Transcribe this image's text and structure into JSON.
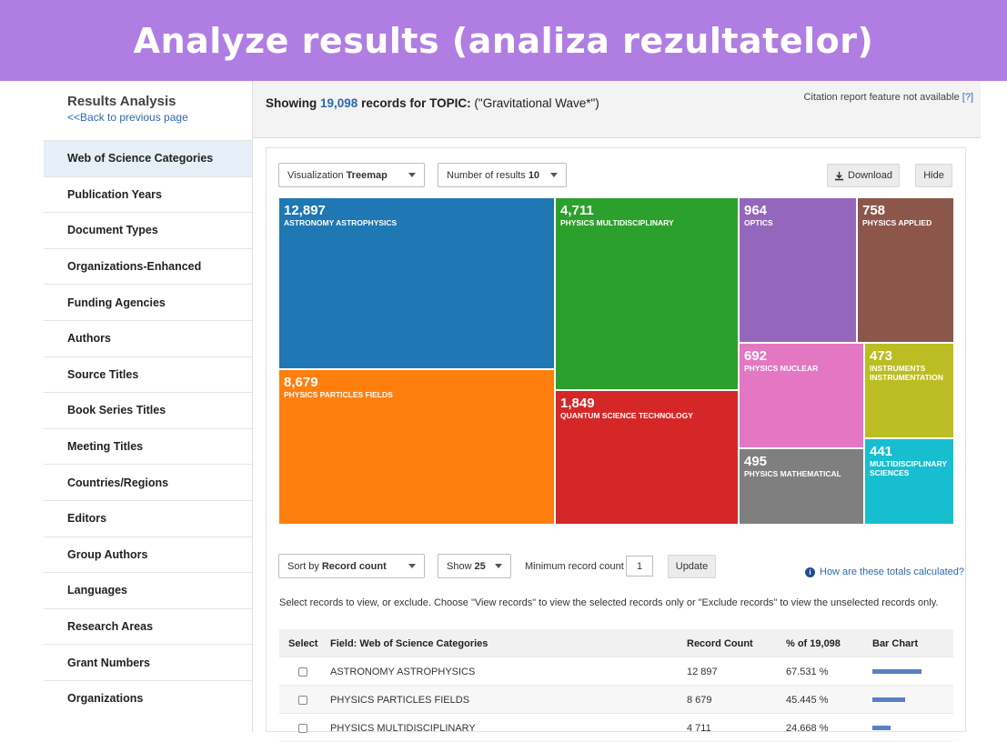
{
  "banner": {
    "title": "Analyze results (analiza rezultatelor)"
  },
  "sidebar": {
    "title": "Results Analysis",
    "back_link": "<<Back to previous page",
    "items": [
      "Web of Science Categories",
      "Publication Years",
      "Document Types",
      "Organizations-Enhanced",
      "Funding Agencies",
      "Authors",
      "Source Titles",
      "Book Series Titles",
      "Meeting Titles",
      "Countries/Regions",
      "Editors",
      "Group Authors",
      "Languages",
      "Research Areas",
      "Grant Numbers",
      "Organizations"
    ],
    "active_index": 0
  },
  "header": {
    "showing_prefix": "Showing",
    "record_count": "19,098",
    "records_for": "records for",
    "topic_label": "TOPIC:",
    "topic_query": "(\"Gravitational Wave*\")",
    "citation_note": "Citation report feature not available",
    "citation_help": "[?]"
  },
  "controls": {
    "visualization_label": "Visualization",
    "visualization_value": "Treemap",
    "num_results_label": "Number of results",
    "num_results_value": "10",
    "download_label": "Download",
    "hide_label": "Hide"
  },
  "treemap": {
    "colors": {
      "astronomy": "#1f77b4",
      "particles": "#ff7f0e",
      "multidisciplinary": "#2ca02c",
      "quantum": "#d62728",
      "optics": "#9467bd",
      "applied": "#8c564b",
      "nuclear": "#e377c2",
      "instruments": "#bcbd22",
      "mathematical": "#7f7f7f",
      "multi_sciences": "#17becf"
    },
    "cells": [
      {
        "value": "12,897",
        "label": "ASTRONOMY ASTROPHYSICS"
      },
      {
        "value": "8,679",
        "label": "PHYSICS PARTICLES FIELDS"
      },
      {
        "value": "4,711",
        "label": "PHYSICS MULTIDISCIPLINARY"
      },
      {
        "value": "1,849",
        "label": "QUANTUM SCIENCE TECHNOLOGY"
      },
      {
        "value": "964",
        "label": "OPTICS"
      },
      {
        "value": "758",
        "label": "PHYSICS APPLIED"
      },
      {
        "value": "692",
        "label": "PHYSICS NUCLEAR"
      },
      {
        "value": "473",
        "label": "INSTRUMENTS INSTRUMENTATION"
      },
      {
        "value": "495",
        "label": "PHYSICS MATHEMATICAL"
      },
      {
        "value": "441",
        "label": "MULTIDISCIPLINARY SCIENCES"
      }
    ]
  },
  "filters": {
    "sort_label": "Sort by",
    "sort_value": "Record count",
    "show_label": "Show",
    "show_value": "25",
    "min_label": "Minimum record count",
    "min_value": "1",
    "update_label": "Update",
    "how_link": "How are these totals calculated?"
  },
  "instructions": "Select records to view, or exclude. Choose \"View records\" to view the selected records only or \"Exclude records\" to view the unselected records only.",
  "table": {
    "headers": {
      "select": "Select",
      "field": "Field: Web of Science Categories",
      "count": "Record Count",
      "percent": "% of 19,098",
      "bar": "Bar Chart"
    },
    "rows": [
      {
        "field": "ASTRONOMY ASTROPHYSICS",
        "count": "12 897",
        "percent": "67.531 %",
        "share": 0.67531
      },
      {
        "field": "PHYSICS PARTICLES FIELDS",
        "count": "8 679",
        "percent": "45.445 %",
        "share": 0.45445
      },
      {
        "field": "PHYSICS MULTIDISCIPLINARY",
        "count": "4 711",
        "percent": "24.668 %",
        "share": 0.24668
      }
    ]
  }
}
